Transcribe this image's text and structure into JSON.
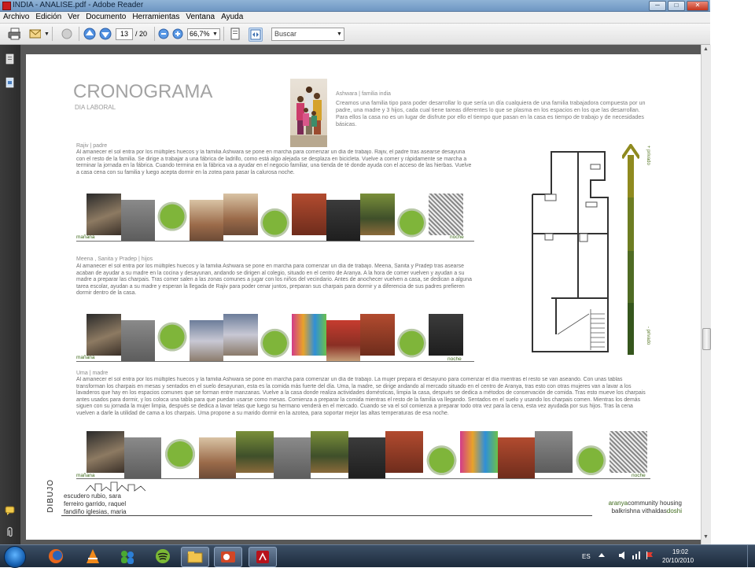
{
  "window": {
    "title": "INDIA - ANALISE.pdf - Adobe Reader"
  },
  "menu": [
    "Archivo",
    "Edición",
    "Ver",
    "Documento",
    "Herramientas",
    "Ventana",
    "Ayuda"
  ],
  "toolbar": {
    "page_current": "13",
    "page_total": "/ 20",
    "zoom": "66,7%",
    "search_placeholder": "Buscar"
  },
  "document": {
    "title": "CRONOGRAMA",
    "subtitle": "DIA LABORAL",
    "intro_heading": "Ashwara | familia india",
    "intro_text": "Creamos una familia tipo para poder desarrollar lo que sería un día cualquiera de una familia trabajadora compuesta por un padre, una madre y 3 hijos, cada cual tiene tareas diferentes lo que se plasma en los espacios en los que las desarrollan. Para ellos la casa no es un lugar de disfrute por ello el tiempo que pasan en la casa es tiempo de trabajo y de necesidades básicas.",
    "sections": [
      {
        "heading": "Rajiv | padre",
        "text": "Al amanecer el sol entra por los múltiples huecos y la familia Ashwara se pone en marcha para comenzar un día de trabajo. Rajiv, el padre tras asearse desayuna con el resto de la familia. Se dirige a trabajar a una fábrica de ladrillo, como está algo alejada se desplaza en bicicleta. Vuelve a comer y rápidamente se marcha a terminar la jornada en la fábrica. Cuando termina en la fábrica va a ayudar en el negocio familiar, una tienda de té donde ayuda con el acceso de las hierbas. Vuelve a casa cena con su familia y luego acepta dormir en la zotea para pasar la calurosa noche.",
        "start": "mañana",
        "end": "noche"
      },
      {
        "heading": "Meena , Sanita y Pradep | hijos",
        "text": "Al amanecer el sol entra por los múltiples huecos y la familia Ashwara se pone en marcha para comenzar un día de trabajo. Meena, Sanita y Pradep tras asearse acaban de ayudar a su madre en la cocina y desayunan, andando se dirigen al colegio, situado en el centro de Aranya. A la hora de comer vuelven y ayudan a su madre a preparar las charpais. Tras comer salen a las zonas comunes a jugar con los niños del vecindario. Antes de anochecer vuelven a casa, se dedican a alguna tarea escolar, ayudan a su madre y esperan la llegada de Rajiv para poder cenar juntos, preparan sus charpais para dormir y a diferencia de sus padres prefieren dormir dentro de la casa.",
        "start": "mañana",
        "end": "noche"
      },
      {
        "heading": "Uma | madre",
        "text": "Al amanecer el sol entra por los múltiples huecos y la familia Ashwara se pone en marcha para comenzar un día de trabajo. La mujer prepara el desayuno para comenzar el día mientras el resto se van aseando. Con unas tablas transforman los charpais en mesas y sentados en el suelo desayunan, esta es la comida más fuerte del día. Uma, la madre, se dirige andando al mercado situado en el centro de Aranya, tras esto con otras mujeres van a lavar a los lavaderos que hay en los espacios comunes que se forman entre manzanas. Vuelve a la casa donde realiza actividades domésticas, limpia la casa, después se dedica a métodos de conservación de comida. Tras esto mueve los charpais antes usados para dormir, y los coloca una tabla para que puedan usarse como mesas. Comienza a preparar la comida mientras el resto de la familia va llegando. Sentados en el suelo y usando los charpais comen. Mientras los demás siguen con su jornada la mujer limpia, después se dedica a lavar telas que luego su hermano venderá en el mercado. Cuando se va el sol comienza a preparar todo otra vez para la cena, esta vez ayudada por sus hijos. Tras la cena vuelven a darle la utilidad de cama a los charpais. Uma propone a su marido dormir en la azotea, para soportar mejor las altas temperaturas de esa noche.",
        "start": "mañana",
        "end": "noche"
      }
    ],
    "legend_top": "+ privado",
    "legend_bottom": "- privado",
    "logo_word": "DIBUJO",
    "authors": [
      "escudero rubio, sara",
      "ferreiro garrido, raquel",
      "fandiño iglesias, maria"
    ],
    "brand_line1_part1": "aranya",
    "brand_line1_part2": "community housing",
    "brand_line2_part1": "balkrishna vithaldas",
    "brand_line2_part2": "doshi"
  },
  "tray": {
    "lang": "ES",
    "time": "19:02",
    "date": "20/10/2010"
  },
  "colors": {
    "accent_green": "#3f6b1c",
    "olive": "#8f8a1f",
    "taskbar": "#1c2a3b"
  }
}
